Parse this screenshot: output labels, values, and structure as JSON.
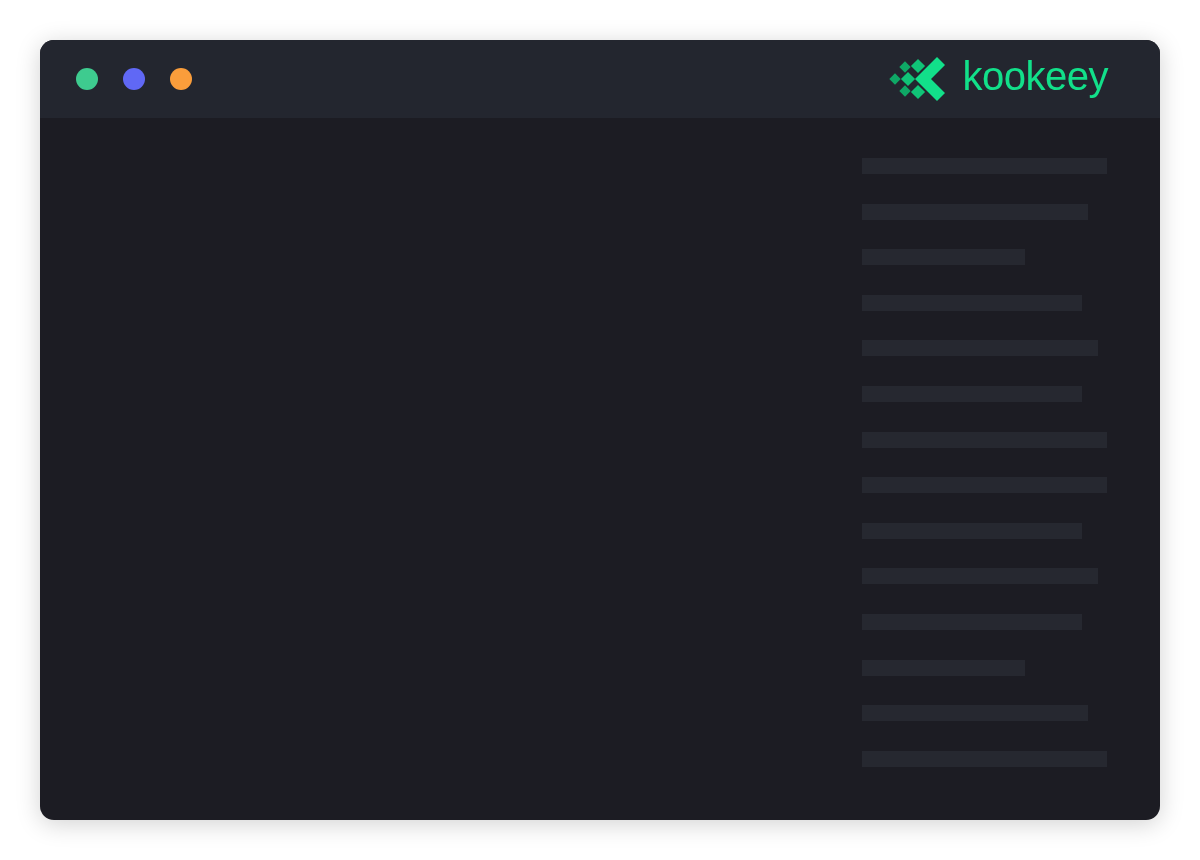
{
  "window": {
    "controls": [
      {
        "color": "#3ecb8f"
      },
      {
        "color": "#6068f5"
      },
      {
        "color": "#fa9d3b"
      }
    ],
    "logo": "kookeey"
  },
  "placeholder_lines": [
    {
      "kind": "full"
    },
    {
      "kind": "medium"
    },
    {
      "kind": "short"
    },
    {
      "kind": "mid"
    },
    {
      "kind": "wide"
    },
    {
      "kind": "mid"
    },
    {
      "kind": "full"
    },
    {
      "kind": "full"
    },
    {
      "kind": "mid"
    },
    {
      "kind": "wide"
    },
    {
      "kind": "mid"
    },
    {
      "kind": "short"
    },
    {
      "kind": "medium"
    },
    {
      "kind": "full"
    }
  ]
}
